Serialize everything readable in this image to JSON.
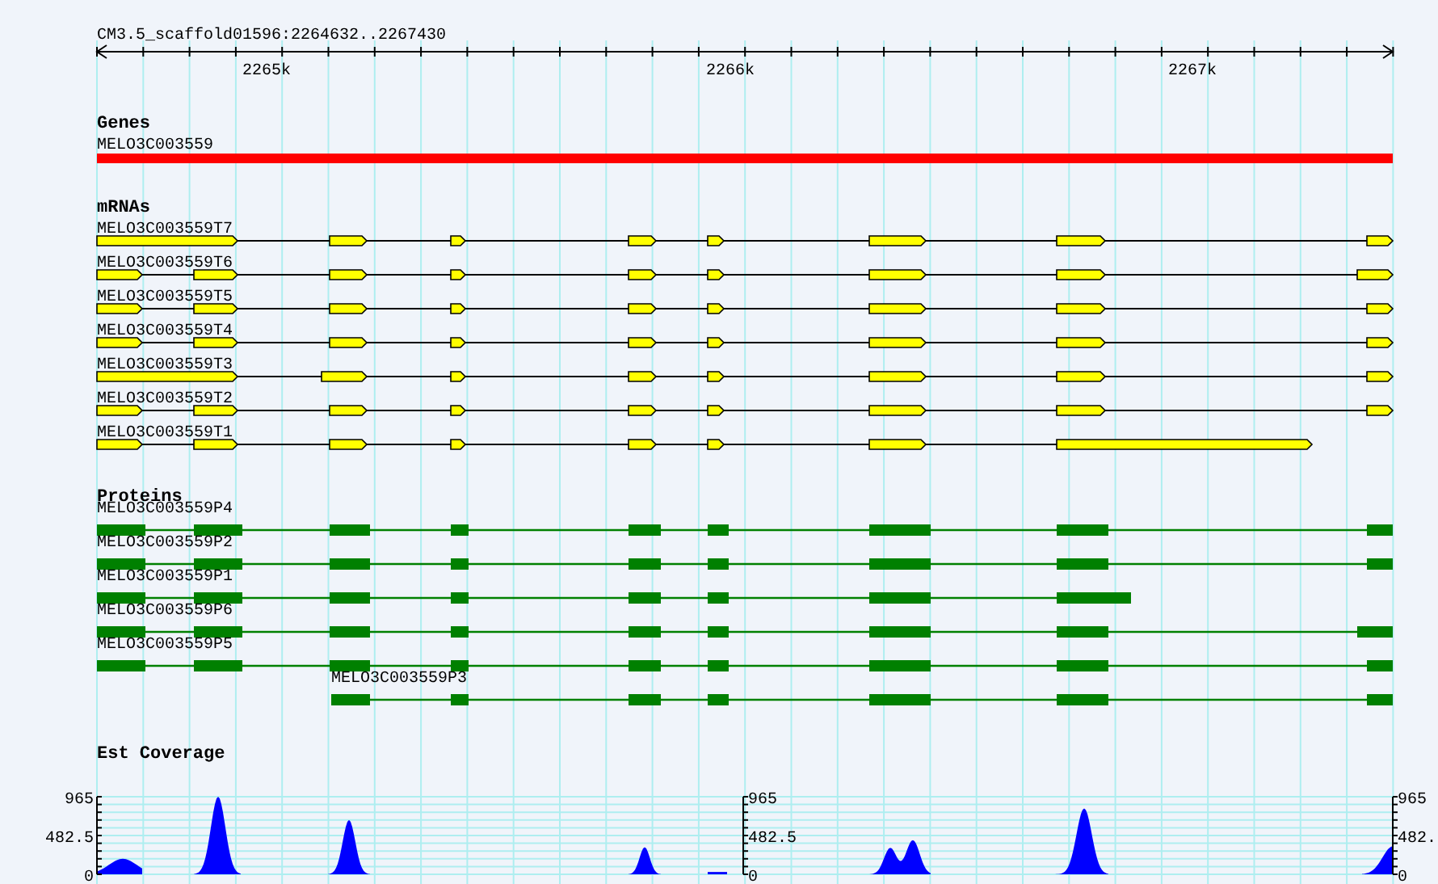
{
  "region": "CM3.5_scaffold01596:2264632..2267430",
  "ruler_labels": [
    "2265k",
    "2266k",
    "2267k"
  ],
  "tracks": [
    {
      "kind": "gene",
      "title": "Genes",
      "features": [
        {
          "label": "MELO3C003559"
        }
      ]
    },
    {
      "kind": "mrna",
      "title": "mRNAs",
      "features": [
        {
          "label": "MELO3C003559T7"
        },
        {
          "label": "MELO3C003559T6"
        },
        {
          "label": "MELO3C003559T5"
        },
        {
          "label": "MELO3C003559T4"
        },
        {
          "label": "MELO3C003559T3"
        },
        {
          "label": "MELO3C003559T2"
        },
        {
          "label": "MELO3C003559T1"
        }
      ]
    },
    {
      "kind": "protein",
      "title": "Proteins",
      "features": [
        {
          "label": "MELO3C003559P4"
        },
        {
          "label": "MELO3C003559P2"
        },
        {
          "label": "MELO3C003559P1"
        },
        {
          "label": "MELO3C003559P6"
        },
        {
          "label": "MELO3C003559P5"
        },
        {
          "label": "MELO3C003559P3"
        }
      ]
    },
    {
      "kind": "coverage",
      "title": "Est Coverage",
      "axes": [
        {
          "max": "965",
          "mid": "482.5",
          "min": "0"
        },
        {
          "max": "965",
          "mid": "482.5",
          "min": "0"
        },
        {
          "max": "965",
          "mid": "482.",
          "min": "0"
        }
      ]
    }
  ]
}
